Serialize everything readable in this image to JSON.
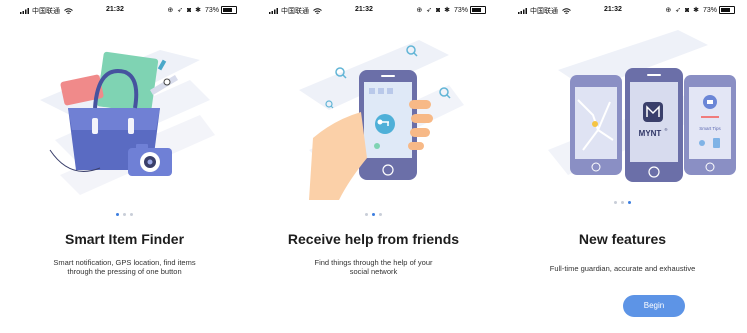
{
  "status_bar": {
    "carrier": "中国联通",
    "time": "21:32",
    "battery": "73%"
  },
  "screens": [
    {
      "title": "Smart Item Finder",
      "desc_lines": [
        "Smart notification, GPS location, find items",
        "through the pressing of one button"
      ],
      "dots_active": 0
    },
    {
      "title": "Receive help from friends",
      "desc_lines": [
        "Find things through the help of your",
        "social network"
      ],
      "dots_active": 1
    },
    {
      "title": "New features",
      "desc_lines": [
        "Full-time guardian, accurate and exhaustive"
      ],
      "dots_active": 2,
      "button": "Begin",
      "phone_labels": {
        "brand": "MYNT",
        "reg": "®",
        "smart_tips": "Smart Tips"
      }
    }
  ],
  "colors": {
    "accent": "#5d94e6",
    "dot_active": "#3d7ee0",
    "dot_inactive": "#c9ced8",
    "phone_body": "#6b6fa8"
  }
}
